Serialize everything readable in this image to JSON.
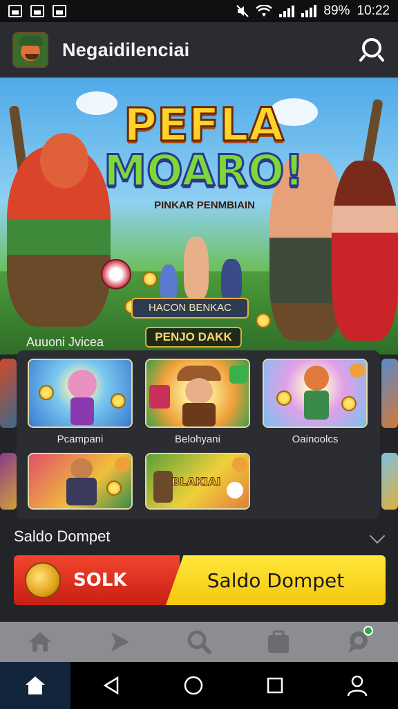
{
  "status_bar": {
    "battery": "89%",
    "time": "10:22"
  },
  "header": {
    "app_title": "Negaidilenciai"
  },
  "hero": {
    "title_line1": "PEFLA",
    "title_line2": "MOARO!",
    "subtitle": "PINKAR PENMBIAIN",
    "banner_text": "HACON BENKAC",
    "cta_label": "PENJO DAKK"
  },
  "games": {
    "section_label": "Auuoni Jvicea",
    "tiles": [
      {
        "label": "Pcampani"
      },
      {
        "label": "Belohyani"
      },
      {
        "label": "Oainoolcs"
      },
      {
        "label": ""
      },
      {
        "label": ""
      }
    ],
    "tile2_art_text": "BLAKIAI"
  },
  "saldo": {
    "title": "Saldo Dompet",
    "left_label": "SOLK",
    "right_label": "Saldo Dompet"
  },
  "bottom_nav": {
    "items": [
      "home",
      "play",
      "search",
      "wallet",
      "chat"
    ]
  },
  "colors": {
    "accent_red": "#e53424",
    "accent_yellow": "#fbd31a",
    "header_bg": "#2a2c31"
  }
}
